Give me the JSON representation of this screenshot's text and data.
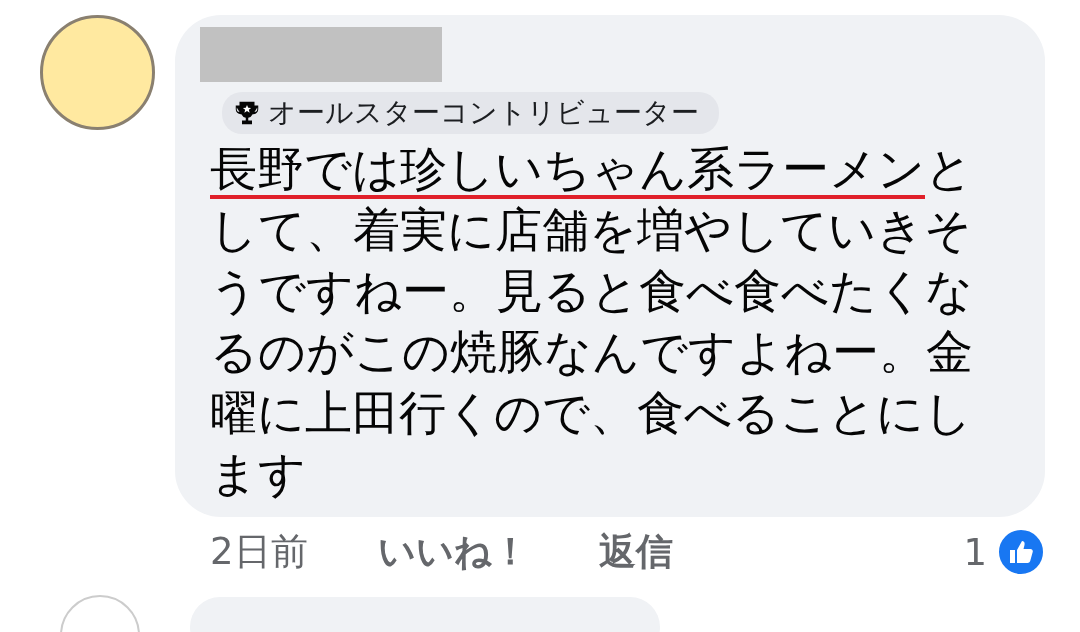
{
  "comment": {
    "badge": "オールスターコントリビューター",
    "text": [
      {
        "text": "長野では珍しいちゃん系ラーメン",
        "underlined": true
      },
      {
        "text": "として、着実に店舗を増やしていきそうですねー。見ると食べ食べたくなるのがこの焼豚なんですよねー。金曜に上田行くので、食べることにします",
        "underlined": false
      }
    ]
  },
  "actions": [
    {
      "label": "2日前",
      "kind": "time"
    },
    {
      "label": "いいね！",
      "kind": "link"
    },
    {
      "label": "返信",
      "kind": "link"
    }
  ],
  "reactions": {
    "count": "1"
  }
}
